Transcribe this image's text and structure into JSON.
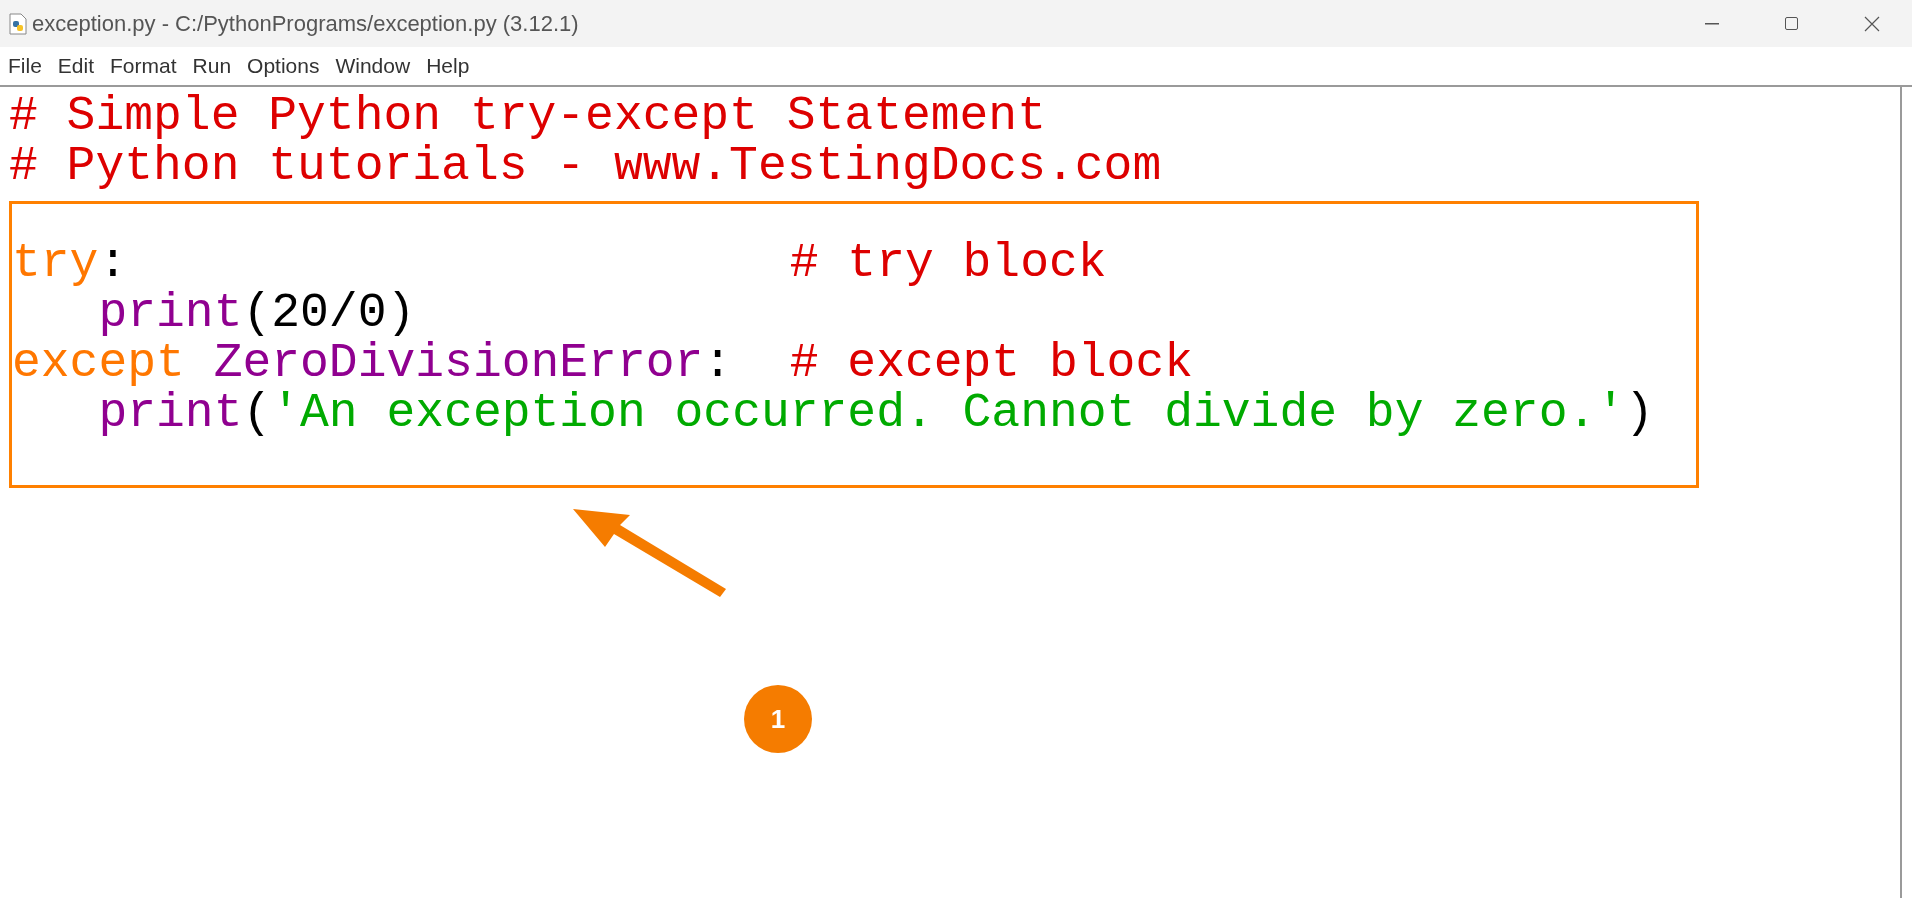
{
  "window": {
    "title": "exception.py - C:/PythonPrograms/exception.py (3.12.1)"
  },
  "menu": [
    "File",
    "Edit",
    "Format",
    "Run",
    "Options",
    "Window",
    "Help"
  ],
  "editor": {
    "lines": [
      {
        "indent": false,
        "tokens": [
          {
            "kind": "comment",
            "text": "# Simple Python try-except Statement"
          }
        ]
      },
      {
        "indent": false,
        "tokens": [
          {
            "kind": "comment",
            "text": "# Python tutorials - www.TestingDocs.com"
          }
        ]
      }
    ],
    "highlighted_lines": [
      {
        "indent": false,
        "tokens": [
          {
            "kind": "keyword",
            "text": "try"
          },
          {
            "kind": "plain",
            "text": ":                       "
          },
          {
            "kind": "comment",
            "text": "# try block"
          }
        ]
      },
      {
        "indent": true,
        "tokens": [
          {
            "kind": "builtin",
            "text": "print"
          },
          {
            "kind": "plain",
            "text": "(20/0)"
          }
        ]
      },
      {
        "indent": false,
        "tokens": [
          {
            "kind": "keyword",
            "text": "except"
          },
          {
            "kind": "builtin",
            "text": " ZeroDivisionError"
          },
          {
            "kind": "plain",
            "text": ":  "
          },
          {
            "kind": "comment",
            "text": "# except block"
          }
        ]
      },
      {
        "indent": true,
        "tokens": [
          {
            "kind": "builtin",
            "text": "print"
          },
          {
            "kind": "plain",
            "text": "("
          },
          {
            "kind": "string",
            "text": "'An exception occurred. Cannot divide by zero.'"
          },
          {
            "kind": "plain",
            "text": ")"
          }
        ]
      }
    ]
  },
  "annotation": {
    "badge": "1"
  }
}
